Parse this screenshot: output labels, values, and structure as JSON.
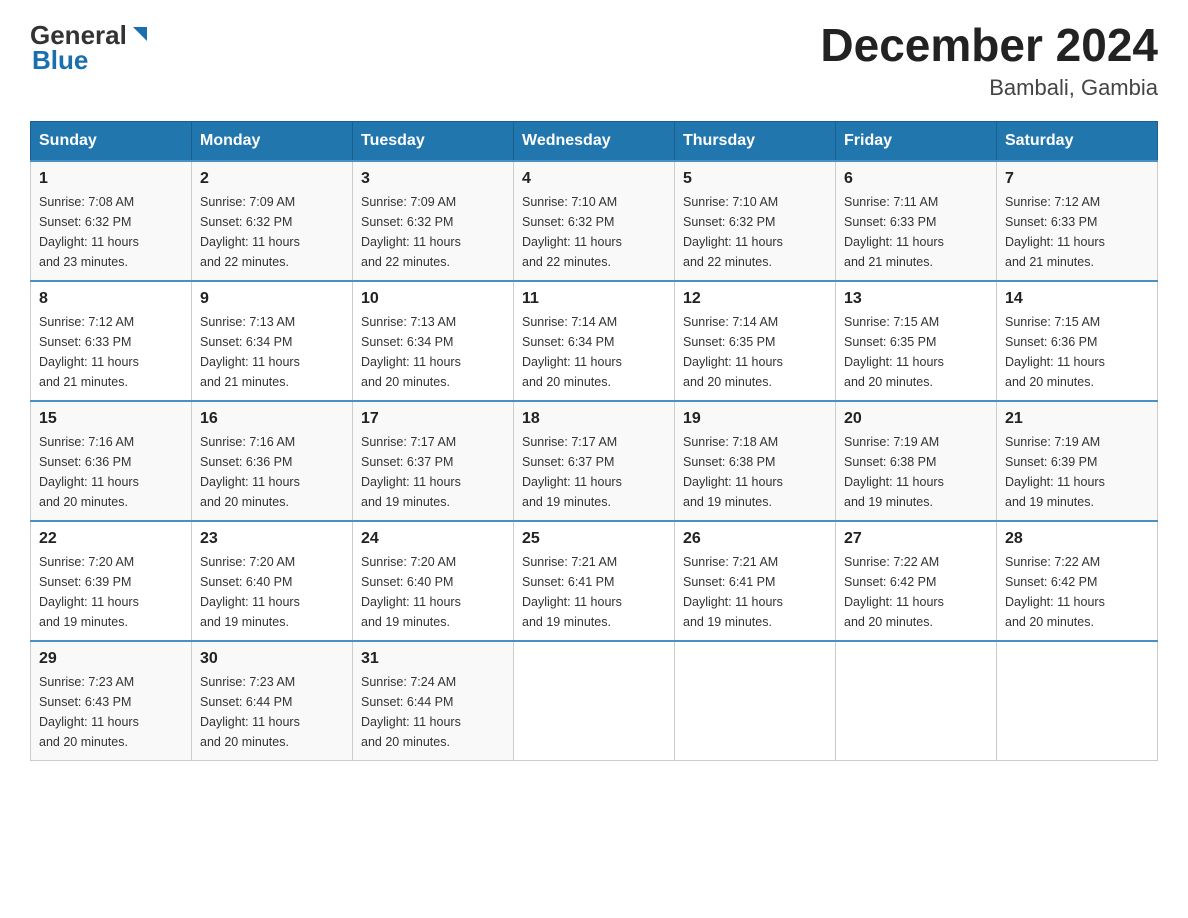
{
  "header": {
    "logo": {
      "general": "General",
      "blue": "Blue"
    },
    "title": "December 2024",
    "subtitle": "Bambali, Gambia"
  },
  "days_of_week": [
    "Sunday",
    "Monday",
    "Tuesday",
    "Wednesday",
    "Thursday",
    "Friday",
    "Saturday"
  ],
  "weeks": [
    [
      {
        "day": "1",
        "sunrise": "7:08 AM",
        "sunset": "6:32 PM",
        "daylight": "11 hours and 23 minutes."
      },
      {
        "day": "2",
        "sunrise": "7:09 AM",
        "sunset": "6:32 PM",
        "daylight": "11 hours and 22 minutes."
      },
      {
        "day": "3",
        "sunrise": "7:09 AM",
        "sunset": "6:32 PM",
        "daylight": "11 hours and 22 minutes."
      },
      {
        "day": "4",
        "sunrise": "7:10 AM",
        "sunset": "6:32 PM",
        "daylight": "11 hours and 22 minutes."
      },
      {
        "day": "5",
        "sunrise": "7:10 AM",
        "sunset": "6:32 PM",
        "daylight": "11 hours and 22 minutes."
      },
      {
        "day": "6",
        "sunrise": "7:11 AM",
        "sunset": "6:33 PM",
        "daylight": "11 hours and 21 minutes."
      },
      {
        "day": "7",
        "sunrise": "7:12 AM",
        "sunset": "6:33 PM",
        "daylight": "11 hours and 21 minutes."
      }
    ],
    [
      {
        "day": "8",
        "sunrise": "7:12 AM",
        "sunset": "6:33 PM",
        "daylight": "11 hours and 21 minutes."
      },
      {
        "day": "9",
        "sunrise": "7:13 AM",
        "sunset": "6:34 PM",
        "daylight": "11 hours and 21 minutes."
      },
      {
        "day": "10",
        "sunrise": "7:13 AM",
        "sunset": "6:34 PM",
        "daylight": "11 hours and 20 minutes."
      },
      {
        "day": "11",
        "sunrise": "7:14 AM",
        "sunset": "6:34 PM",
        "daylight": "11 hours and 20 minutes."
      },
      {
        "day": "12",
        "sunrise": "7:14 AM",
        "sunset": "6:35 PM",
        "daylight": "11 hours and 20 minutes."
      },
      {
        "day": "13",
        "sunrise": "7:15 AM",
        "sunset": "6:35 PM",
        "daylight": "11 hours and 20 minutes."
      },
      {
        "day": "14",
        "sunrise": "7:15 AM",
        "sunset": "6:36 PM",
        "daylight": "11 hours and 20 minutes."
      }
    ],
    [
      {
        "day": "15",
        "sunrise": "7:16 AM",
        "sunset": "6:36 PM",
        "daylight": "11 hours and 20 minutes."
      },
      {
        "day": "16",
        "sunrise": "7:16 AM",
        "sunset": "6:36 PM",
        "daylight": "11 hours and 20 minutes."
      },
      {
        "day": "17",
        "sunrise": "7:17 AM",
        "sunset": "6:37 PM",
        "daylight": "11 hours and 19 minutes."
      },
      {
        "day": "18",
        "sunrise": "7:17 AM",
        "sunset": "6:37 PM",
        "daylight": "11 hours and 19 minutes."
      },
      {
        "day": "19",
        "sunrise": "7:18 AM",
        "sunset": "6:38 PM",
        "daylight": "11 hours and 19 minutes."
      },
      {
        "day": "20",
        "sunrise": "7:19 AM",
        "sunset": "6:38 PM",
        "daylight": "11 hours and 19 minutes."
      },
      {
        "day": "21",
        "sunrise": "7:19 AM",
        "sunset": "6:39 PM",
        "daylight": "11 hours and 19 minutes."
      }
    ],
    [
      {
        "day": "22",
        "sunrise": "7:20 AM",
        "sunset": "6:39 PM",
        "daylight": "11 hours and 19 minutes."
      },
      {
        "day": "23",
        "sunrise": "7:20 AM",
        "sunset": "6:40 PM",
        "daylight": "11 hours and 19 minutes."
      },
      {
        "day": "24",
        "sunrise": "7:20 AM",
        "sunset": "6:40 PM",
        "daylight": "11 hours and 19 minutes."
      },
      {
        "day": "25",
        "sunrise": "7:21 AM",
        "sunset": "6:41 PM",
        "daylight": "11 hours and 19 minutes."
      },
      {
        "day": "26",
        "sunrise": "7:21 AM",
        "sunset": "6:41 PM",
        "daylight": "11 hours and 19 minutes."
      },
      {
        "day": "27",
        "sunrise": "7:22 AM",
        "sunset": "6:42 PM",
        "daylight": "11 hours and 20 minutes."
      },
      {
        "day": "28",
        "sunrise": "7:22 AM",
        "sunset": "6:42 PM",
        "daylight": "11 hours and 20 minutes."
      }
    ],
    [
      {
        "day": "29",
        "sunrise": "7:23 AM",
        "sunset": "6:43 PM",
        "daylight": "11 hours and 20 minutes."
      },
      {
        "day": "30",
        "sunrise": "7:23 AM",
        "sunset": "6:44 PM",
        "daylight": "11 hours and 20 minutes."
      },
      {
        "day": "31",
        "sunrise": "7:24 AM",
        "sunset": "6:44 PM",
        "daylight": "11 hours and 20 minutes."
      },
      null,
      null,
      null,
      null
    ]
  ],
  "labels": {
    "sunrise": "Sunrise:",
    "sunset": "Sunset:",
    "daylight": "Daylight:"
  }
}
